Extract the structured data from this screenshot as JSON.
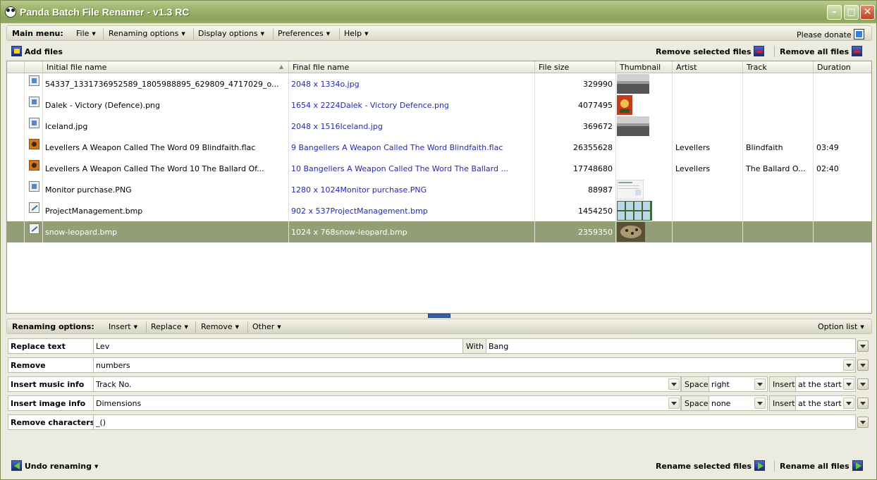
{
  "window": {
    "title": "Panda Batch File Renamer - v1.3 RC"
  },
  "menu": {
    "main_label": "Main menu:",
    "items": [
      "File",
      "Renaming options",
      "Display options",
      "Preferences",
      "Help"
    ],
    "donate": "Please donate"
  },
  "toolbar": {
    "add_files": "Add files",
    "remove_selected": "Remove selected files",
    "remove_all": "Remove all files"
  },
  "grid": {
    "columns": [
      "Initial file name",
      "Final file name",
      "File size",
      "Thumbnail",
      "Artist",
      "Track",
      "Duration"
    ],
    "rows": [
      {
        "initial": "54337_1331736952589_1805988895_629809_4717029_o...",
        "final": "2048 x 1334o.jpg",
        "size": "329990",
        "artist": "",
        "track": "",
        "duration": "",
        "icon": "image-file-icon",
        "thumb": "grayscale-landscape"
      },
      {
        "initial": "Dalek - Victory (Defence).png",
        "final": "1654 x 2224Dalek - Victory Defence.png",
        "size": "4077495",
        "artist": "",
        "track": "",
        "duration": "",
        "icon": "image-file-icon",
        "thumb": "poster"
      },
      {
        "initial": "Iceland.jpg",
        "final": "2048 x 1516Iceland.jpg",
        "size": "369672",
        "artist": "",
        "track": "",
        "duration": "",
        "icon": "image-file-icon",
        "thumb": "grayscale-landscape"
      },
      {
        "initial": "Levellers  A Weapon Called The Word  09  Blindfaith.flac",
        "final": "9 Bangellers  A Weapon Called The Word    Blindfaith.flac",
        "size": "26355628",
        "artist": "Levellers",
        "track": "Blindfaith",
        "duration": "03:49",
        "icon": "audio-file-icon",
        "thumb": ""
      },
      {
        "initial": "Levellers  A Weapon Called The Word  10  The Ballard Of...",
        "final": "10 Bangellers  A Weapon Called The Word    The Ballard ...",
        "size": "17748680",
        "artist": "Levellers",
        "track": "The Ballard O...",
        "duration": "02:40",
        "icon": "audio-file-icon",
        "thumb": ""
      },
      {
        "initial": "Monitor purchase.PNG",
        "final": "1280 x 1024Monitor purchase.PNG",
        "size": "88987",
        "artist": "",
        "track": "",
        "duration": "",
        "icon": "image-file-icon",
        "thumb": "screenshot"
      },
      {
        "initial": "ProjectManagement.bmp",
        "final": "902 x 537ProjectManagement.bmp",
        "size": "1454250",
        "artist": "",
        "track": "",
        "duration": "",
        "icon": "bitmap-file-icon",
        "thumb": "grid"
      },
      {
        "initial": "snow-leopard.bmp",
        "final": "1024 x 768snow-leopard.bmp",
        "size": "2359350",
        "artist": "",
        "track": "",
        "duration": "",
        "icon": "bitmap-file-icon",
        "thumb": "leopard",
        "selected": true
      }
    ]
  },
  "options_bar": {
    "label": "Renaming options:",
    "items": [
      "Insert",
      "Replace",
      "Remove",
      "Other"
    ],
    "option_list": "Option list"
  },
  "options": {
    "replace": {
      "label": "Replace text",
      "value": "Lev",
      "with_label": "With",
      "with_value": "Bang"
    },
    "remove": {
      "label": "Remove",
      "value": "numbers"
    },
    "music": {
      "label": "Insert music info",
      "value": "Track No.",
      "space_label": "Space",
      "space_value": "right",
      "insert_label": "Insert",
      "insert_value": "at the start"
    },
    "image": {
      "label": "Insert image info",
      "value": "Dimensions",
      "space_label": "Space",
      "space_value": "none",
      "insert_label": "Insert",
      "insert_value": "at the start"
    },
    "chars": {
      "label": "Remove characters",
      "value": "_()"
    }
  },
  "bottom": {
    "undo": "Undo renaming",
    "rename_selected": "Rename selected files",
    "rename_all": "Rename all files"
  }
}
